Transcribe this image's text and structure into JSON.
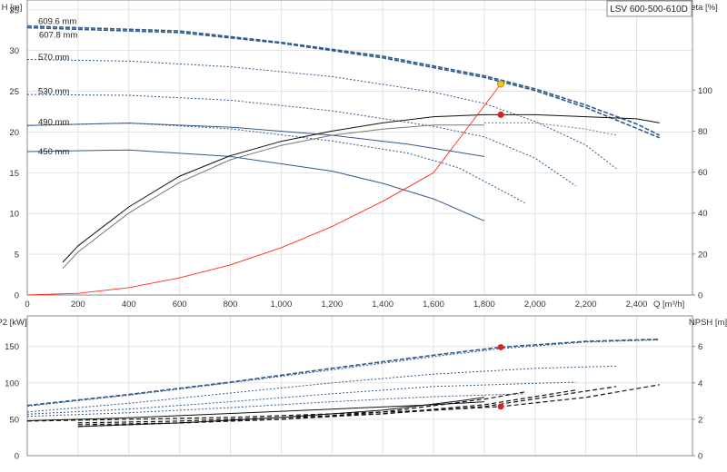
{
  "model_name": "LSV 600-500-610D",
  "colors": {
    "blue": "#2f5a8e",
    "dark": "#111111",
    "grey": "#777777",
    "system": "#ff2a1a",
    "point_red": "#e02020",
    "point_yellow": "#f5c518"
  },
  "chart_data": [
    {
      "type": "line",
      "xlabel": "Q [m³/h]",
      "ylabel": "H [m]",
      "y2label": "eta [%]",
      "xlim": [
        0,
        2620
      ],
      "ylim": [
        0,
        36.2
      ],
      "y2lim": [
        0,
        144
      ],
      "x_ticks": [
        "0",
        "200",
        "400",
        "600",
        "800",
        "1,000",
        "1,200",
        "1,400",
        "1,600",
        "1,800",
        "2,000",
        "2,200",
        "2,400"
      ],
      "y_ticks": [
        "0",
        "5",
        "10",
        "15",
        "20",
        "25",
        "30",
        "35"
      ],
      "y2_ticks": [
        "0",
        "20",
        "40",
        "60",
        "80",
        "100"
      ],
      "grid": true,
      "diameter_labels": [
        {
          "text": "609.6 mm",
          "y": 33.6
        },
        {
          "text": "607.8 mm",
          "y": 31.9
        },
        {
          "text": "570 mm",
          "y": 29.2
        },
        {
          "text": "530 mm",
          "y": 25.0
        },
        {
          "text": "490 mm",
          "y": 21.2
        },
        {
          "text": "450 mm",
          "y": 17.6
        }
      ],
      "series": [
        {
          "role": "head",
          "style": "dashed-blue",
          "x": [
            0,
            600,
            1000,
            1400,
            1800,
            2000,
            2200,
            2400,
            2490
          ],
          "y": [
            33.0,
            32.4,
            31.0,
            29.3,
            26.9,
            25.3,
            23.3,
            21.0,
            19.6
          ]
        },
        {
          "role": "head",
          "style": "dashed-blue",
          "x": [
            0,
            600,
            1000,
            1400,
            1800,
            2000,
            2200,
            2490
          ],
          "y": [
            32.8,
            32.2,
            30.9,
            29.1,
            26.7,
            25.1,
            23.0,
            19.3
          ]
        },
        {
          "role": "head",
          "style": "dotted-blue",
          "x": [
            0,
            400,
            800,
            1200,
            1600,
            1800,
            2000,
            2200,
            2320
          ],
          "y": [
            28.9,
            28.7,
            28.0,
            26.8,
            24.9,
            23.5,
            21.3,
            18.4,
            15.5
          ]
        },
        {
          "role": "head",
          "style": "dotted-blue",
          "x": [
            0,
            400,
            800,
            1200,
            1600,
            1800,
            2000,
            2160
          ],
          "y": [
            24.6,
            24.5,
            23.9,
            22.6,
            20.7,
            19.4,
            16.8,
            13.4
          ]
        },
        {
          "role": "head",
          "style": "dotted-blue",
          "x": [
            0,
            400,
            800,
            1200,
            1500,
            1700,
            1960
          ],
          "y": [
            20.8,
            21.1,
            20.4,
            18.9,
            17.4,
            15.6,
            11.3
          ]
        },
        {
          "role": "head",
          "style": "solid-blue",
          "x": [
            0,
            400,
            800,
            1200,
            1400,
            1600,
            1800
          ],
          "y": [
            17.6,
            17.8,
            17.0,
            15.2,
            13.7,
            11.8,
            9.1
          ]
        },
        {
          "role": "head",
          "style": "solid-blue",
          "x": [
            0,
            400,
            800,
            1200,
            1500,
            1800
          ],
          "y": [
            20.8,
            21.1,
            20.6,
            19.6,
            18.5,
            17.0
          ]
        },
        {
          "role": "efficiency",
          "style": "solid-dark",
          "x": [
            140,
            200,
            400,
            600,
            800,
            1000,
            1200,
            1400,
            1600,
            1800,
            2000,
            2200,
            2400,
            2490
          ],
          "y": [
            16,
            24,
            43,
            58,
            68,
            75,
            80,
            84,
            87,
            88,
            88,
            87,
            86,
            84
          ]
        },
        {
          "role": "efficiency",
          "style": "solid-grey",
          "x": [
            140,
            200,
            400,
            600,
            800,
            1000,
            1200,
            1400,
            1600,
            1800
          ],
          "y": [
            13,
            21,
            40,
            55,
            66,
            73,
            78,
            81,
            83,
            83
          ]
        },
        {
          "role": "efficiency",
          "style": "dotted-grey",
          "x": [
            1800,
            2000,
            2200,
            2320
          ],
          "y": [
            84,
            84,
            81,
            78
          ]
        },
        {
          "role": "system",
          "style": "solid-red",
          "x": [
            0,
            200,
            400,
            600,
            800,
            1000,
            1200,
            1400,
            1600,
            1865
          ],
          "y": [
            0,
            0.2,
            0.9,
            2.1,
            3.7,
            5.8,
            8.4,
            11.5,
            15.0,
            25.9
          ]
        }
      ],
      "points": [
        {
          "name": "duty-point-head",
          "x": 1865,
          "y": 25.9,
          "color": "#f5c518"
        },
        {
          "name": "duty-point-eta",
          "x": 1865,
          "y2": 88,
          "color": "#e02020"
        }
      ]
    },
    {
      "type": "line",
      "ylabel": "P2 [kW]",
      "y2label": "NPSH [m]",
      "xlim": [
        0,
        2620
      ],
      "ylim": [
        0,
        192
      ],
      "y2lim": [
        0,
        7.68
      ],
      "y_ticks": [
        "0",
        "50",
        "100",
        "150"
      ],
      "y2_ticks": [
        "0",
        "2",
        "4",
        "6"
      ],
      "grid": true,
      "series": [
        {
          "role": "power",
          "style": "dashed-blue",
          "x": [
            0,
            400,
            800,
            1200,
            1600,
            1865,
            2200,
            2490
          ],
          "y": [
            69,
            84,
            101,
            120,
            138,
            149,
            157,
            160
          ]
        },
        {
          "role": "power",
          "style": "dotted-blue",
          "x": [
            0,
            400,
            800,
            1200,
            1600,
            1865,
            2200,
            2490
          ],
          "y": [
            68,
            83,
            100,
            118,
            136,
            147,
            156,
            159
          ]
        },
        {
          "role": "power",
          "style": "dotted-blue",
          "x": [
            0,
            400,
            800,
            1200,
            1600,
            2000,
            2320
          ],
          "y": [
            60,
            72,
            86,
            100,
            112,
            120,
            123
          ]
        },
        {
          "role": "power",
          "style": "dotted-blue",
          "x": [
            0,
            400,
            800,
            1200,
            1600,
            2160
          ],
          "y": [
            57,
            64,
            74,
            85,
            95,
            101
          ]
        },
        {
          "role": "power",
          "style": "dotted-blue",
          "x": [
            0,
            400,
            800,
            1200,
            1600,
            1960
          ],
          "y": [
            54,
            59,
            66,
            74,
            81,
            85
          ]
        },
        {
          "role": "power",
          "style": "solid-dark",
          "x": [
            0,
            400,
            800,
            1200,
            1600,
            1800
          ],
          "y": [
            48,
            52,
            58,
            64,
            70,
            74
          ]
        },
        {
          "role": "npsh",
          "style": "dashed-dark",
          "x": [
            0,
            400,
            800,
            1200,
            1600,
            1865,
            2200,
            2490
          ],
          "y": [
            1.9,
            2.0,
            2.1,
            2.3,
            2.5,
            2.7,
            3.2,
            3.9
          ]
        },
        {
          "role": "npsh",
          "style": "dashed-dark",
          "x": [
            200,
            600,
            1000,
            1400,
            1800,
            2320
          ],
          "y": [
            1.8,
            1.9,
            2.1,
            2.3,
            2.7,
            3.8
          ]
        },
        {
          "role": "npsh",
          "style": "dashed-dark",
          "x": [
            200,
            600,
            1000,
            1400,
            1800,
            2160
          ],
          "y": [
            1.7,
            1.8,
            2.0,
            2.3,
            2.8,
            3.6
          ]
        },
        {
          "role": "npsh",
          "style": "dashed-dark",
          "x": [
            200,
            600,
            1000,
            1400,
            1800,
            1960
          ],
          "y": [
            1.6,
            1.8,
            2.0,
            2.4,
            3.1,
            3.5
          ]
        },
        {
          "role": "npsh",
          "style": "solid-dark",
          "x": [
            200,
            600,
            1000,
            1400,
            1700,
            1800
          ],
          "y": [
            1.6,
            1.8,
            2.1,
            2.5,
            3.0,
            3.2
          ]
        }
      ],
      "points": [
        {
          "name": "duty-point-power",
          "x": 1865,
          "y": 149,
          "color": "#e02020"
        },
        {
          "name": "duty-point-npsh",
          "x": 1865,
          "y2": 2.7,
          "color": "#e02020"
        }
      ]
    }
  ]
}
